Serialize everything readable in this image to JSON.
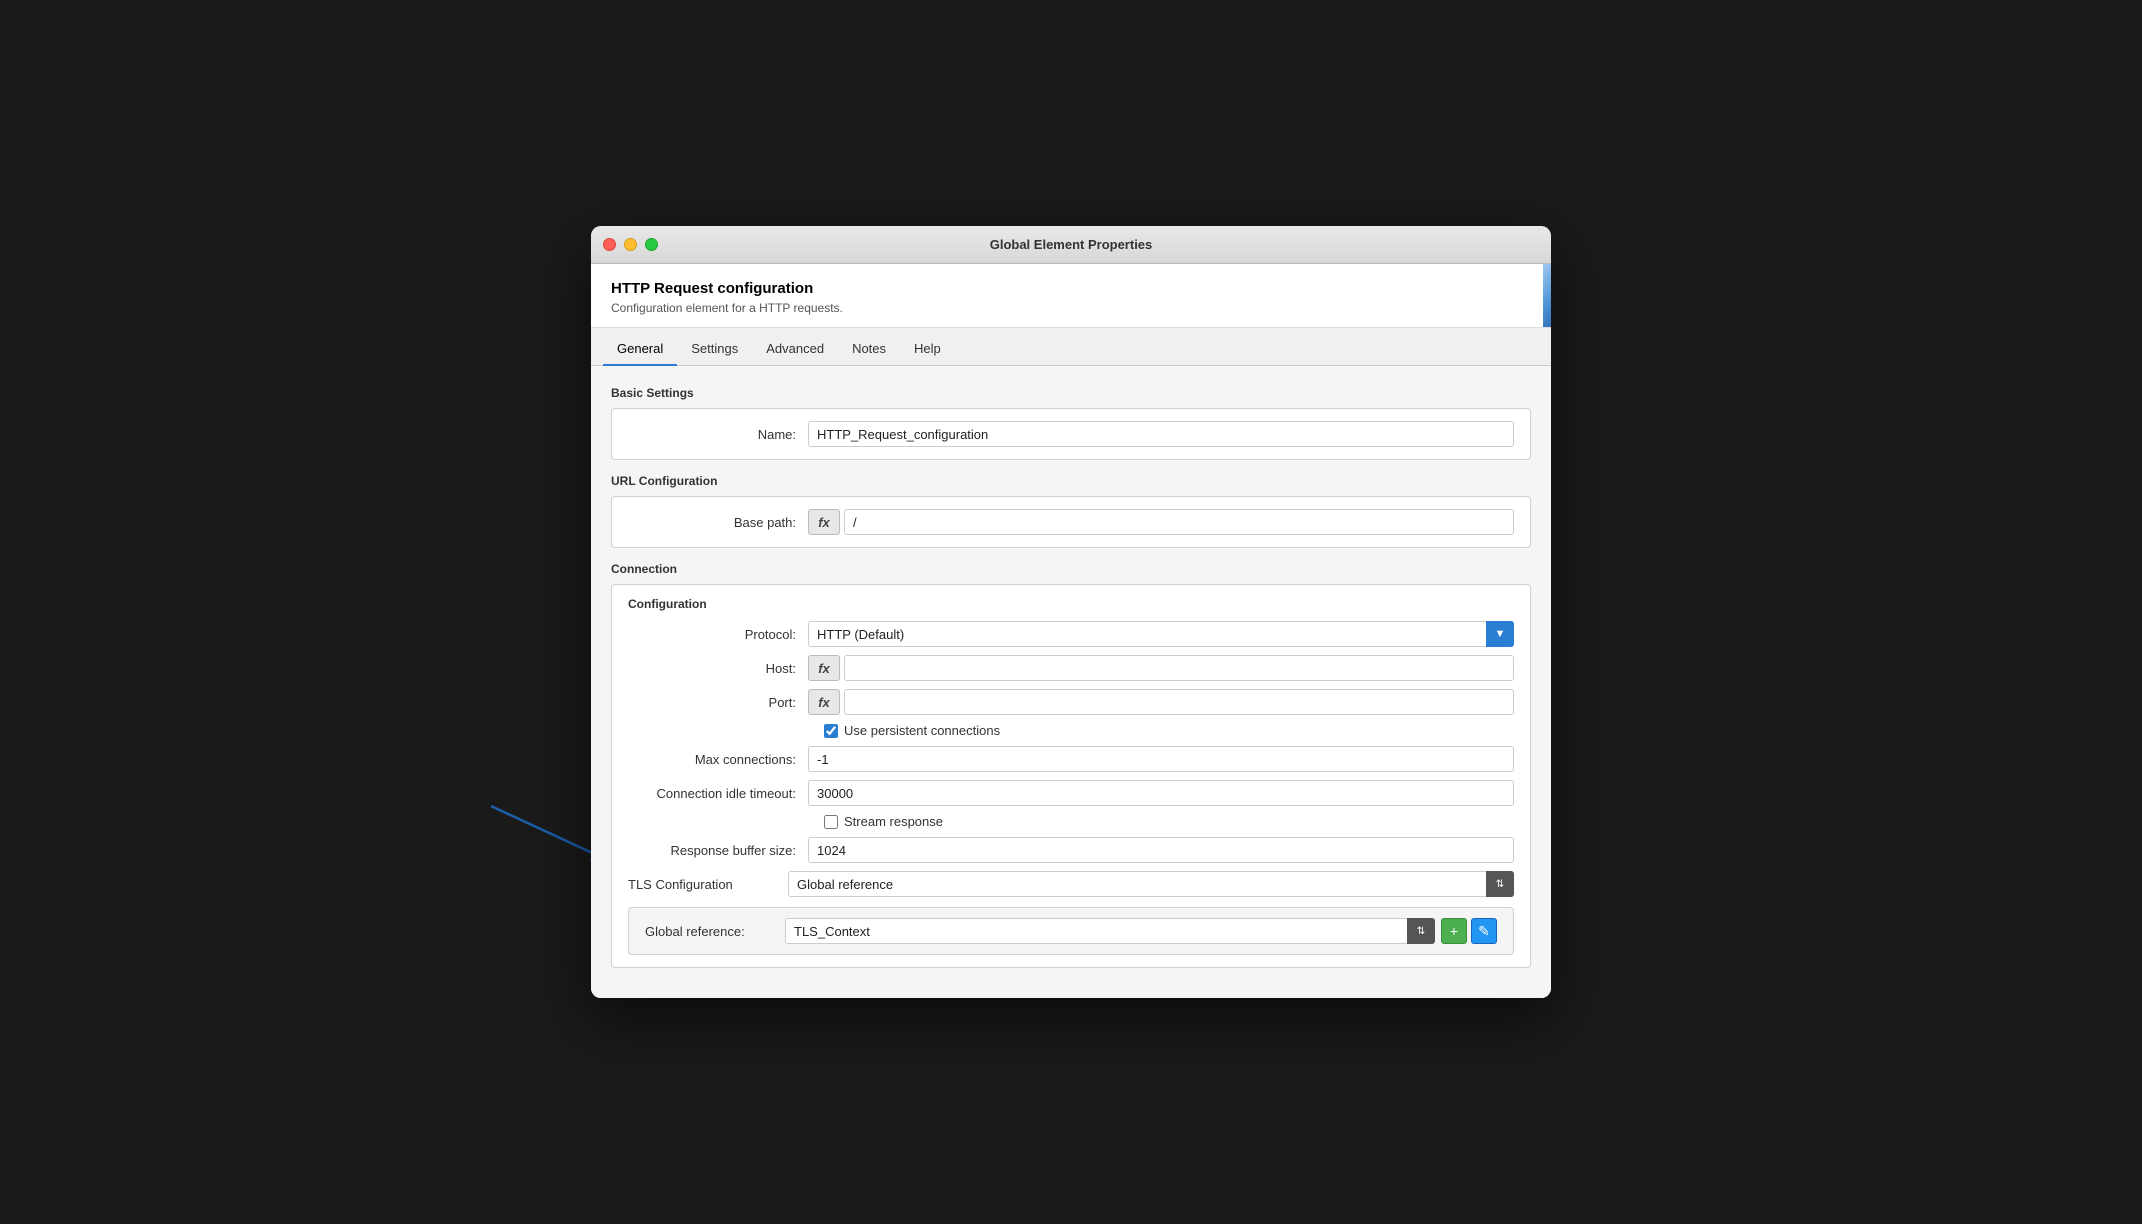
{
  "window": {
    "title": "Global Element Properties"
  },
  "header": {
    "title": "HTTP Request configuration",
    "subtitle": "Configuration element for a HTTP requests."
  },
  "tabs": [
    {
      "label": "General",
      "active": true
    },
    {
      "label": "Settings",
      "active": false
    },
    {
      "label": "Advanced",
      "active": false
    },
    {
      "label": "Notes",
      "active": false
    },
    {
      "label": "Help",
      "active": false
    }
  ],
  "sections": {
    "basic_settings": {
      "title": "Basic Settings",
      "name_label": "Name:",
      "name_value": "HTTP_Request_configuration"
    },
    "url_configuration": {
      "title": "URL Configuration",
      "base_path_label": "Base path:",
      "base_path_value": "/",
      "fx_label": "fx"
    },
    "connection": {
      "title": "Connection",
      "configuration_title": "Configuration",
      "protocol_label": "Protocol:",
      "protocol_value": "HTTP (Default)",
      "host_label": "Host:",
      "host_value": "",
      "port_label": "Port:",
      "port_value": "",
      "use_persistent_label": "Use persistent connections",
      "use_persistent_checked": true,
      "max_connections_label": "Max connections:",
      "max_connections_value": "-1",
      "connection_idle_label": "Connection idle timeout:",
      "connection_idle_value": "30000",
      "stream_response_label": "Stream response",
      "stream_response_checked": false,
      "response_buffer_label": "Response buffer size:",
      "response_buffer_value": "1024",
      "fx_label": "fx"
    },
    "tls": {
      "title": "TLS Configuration",
      "tls_value": "Global reference",
      "global_ref_label": "Global reference:",
      "global_ref_value": "TLS_Context"
    }
  },
  "icons": {
    "chevron_down": "▼",
    "chevron_up_down": "⇅",
    "plus": "+",
    "edit": "✎",
    "fx": "fx"
  },
  "colors": {
    "accent_blue": "#2a7fd4",
    "green_button": "#4caf50",
    "edit_button": "#2196f3"
  }
}
